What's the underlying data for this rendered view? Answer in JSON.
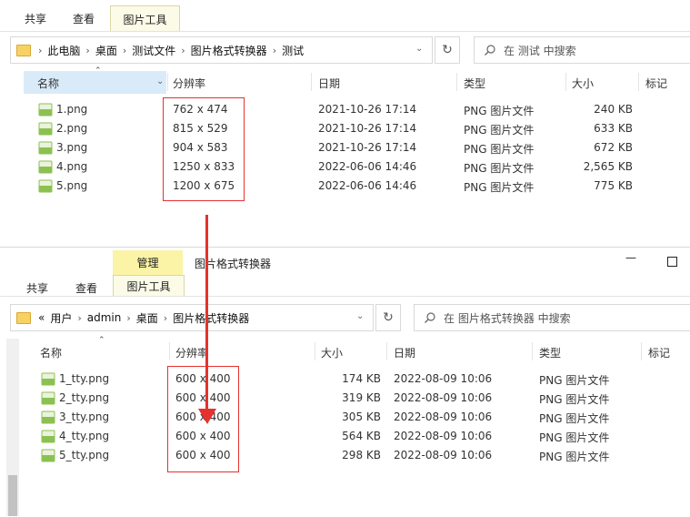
{
  "window_top": {
    "ribbon": {
      "tab_share": "共享",
      "tab_view": "查看",
      "tab_picture_tools": "图片工具"
    },
    "address": {
      "crumbs": [
        "此电脑",
        "桌面",
        "测试文件",
        "图片格式转换器",
        "测试"
      ]
    },
    "search": {
      "placeholder": "在 测试 中搜索"
    },
    "columns": {
      "name": "名称",
      "resolution": "分辨率",
      "date": "日期",
      "type": "类型",
      "size": "大小",
      "tags": "标记"
    },
    "files": [
      {
        "name": "1.png",
        "resolution": "762 x 474",
        "date": "2021-10-26 17:14",
        "type": "PNG 图片文件",
        "size": "240 KB"
      },
      {
        "name": "2.png",
        "resolution": "815 x 529",
        "date": "2021-10-26 17:14",
        "type": "PNG 图片文件",
        "size": "633 KB"
      },
      {
        "name": "3.png",
        "resolution": "904 x 583",
        "date": "2021-10-26 17:14",
        "type": "PNG 图片文件",
        "size": "672 KB"
      },
      {
        "name": "4.png",
        "resolution": "1250 x 833",
        "date": "2022-06-06 14:46",
        "type": "PNG 图片文件",
        "size": "2,565 KB"
      },
      {
        "name": "5.png",
        "resolution": "1200 x 675",
        "date": "2022-06-06 14:46",
        "type": "PNG 图片文件",
        "size": "775 KB"
      }
    ]
  },
  "window_bottom": {
    "title": "图片格式转换器",
    "ribbon": {
      "context_header": "管理",
      "tab_share": "共享",
      "tab_view": "查看",
      "tab_picture_tools": "图片工具"
    },
    "address": {
      "prefix": "«",
      "crumbs": [
        "用户",
        "admin",
        "桌面",
        "图片格式转换器"
      ]
    },
    "search": {
      "placeholder": "在 图片格式转换器 中搜索"
    },
    "columns": {
      "name": "名称",
      "resolution": "分辨率",
      "size": "大小",
      "date": "日期",
      "type": "类型",
      "tags": "标记"
    },
    "files": [
      {
        "name": "1_tty.png",
        "resolution": "600 x 400",
        "size": "174 KB",
        "date": "2022-08-09 10:06",
        "type": "PNG 图片文件"
      },
      {
        "name": "2_tty.png",
        "resolution": "600 x 400",
        "size": "319 KB",
        "date": "2022-08-09 10:06",
        "type": "PNG 图片文件"
      },
      {
        "name": "3_tty.png",
        "resolution": "600 x 400",
        "size": "305 KB",
        "date": "2022-08-09 10:06",
        "type": "PNG 图片文件"
      },
      {
        "name": "4_tty.png",
        "resolution": "600 x 400",
        "size": "564 KB",
        "date": "2022-08-09 10:06",
        "type": "PNG 图片文件"
      },
      {
        "name": "5_tty.png",
        "resolution": "600 x 400",
        "size": "298 KB",
        "date": "2022-08-09 10:06",
        "type": "PNG 图片文件"
      }
    ]
  },
  "colors": {
    "annotation_red": "#e5322e",
    "context_tab_yellow": "#fbf3a6",
    "selected_header_blue": "#d9ebf9",
    "png_icon_green": "#8cc152"
  },
  "icons": [
    "folder-icon",
    "refresh-icon",
    "search-icon",
    "png-file-icon",
    "sort-caret-icon",
    "dropdown-chevron-icon",
    "minimize-icon",
    "maximize-icon"
  ]
}
